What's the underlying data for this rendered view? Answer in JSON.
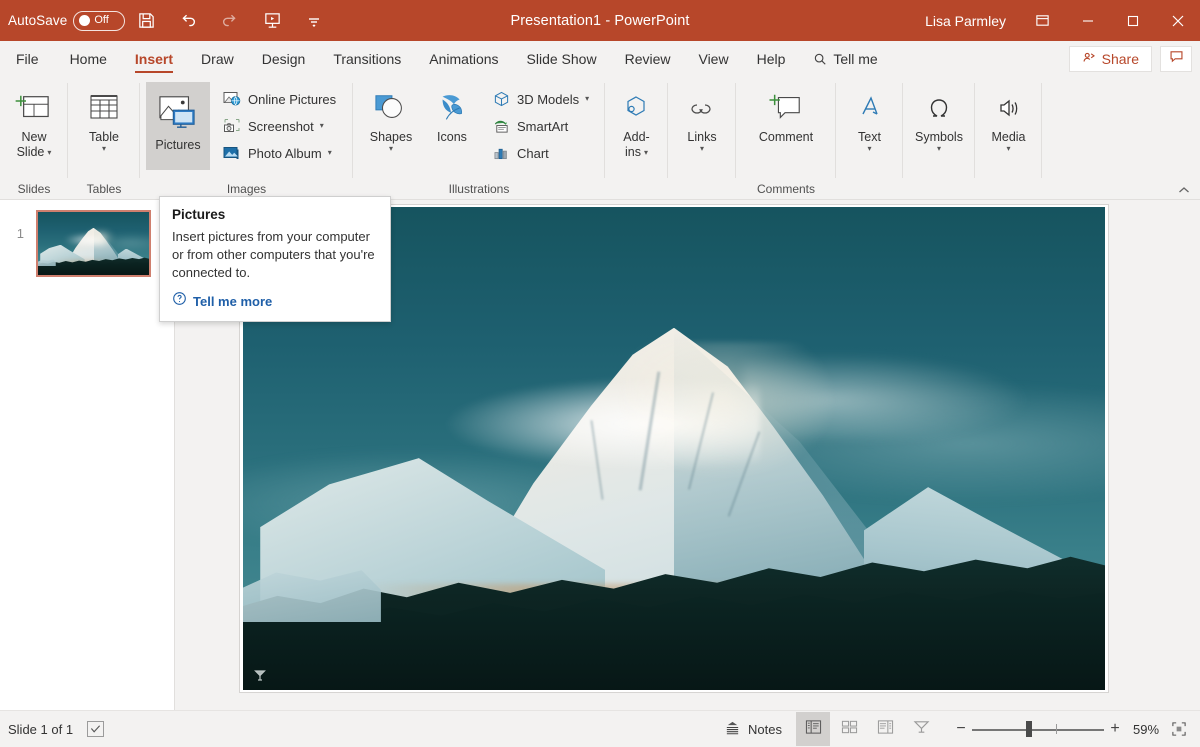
{
  "titlebar": {
    "autosave_label": "AutoSave",
    "autosave_state": "Off",
    "document_title": "Presentation1  -  PowerPoint",
    "user_name": "Lisa Parmley",
    "quick_access": [
      {
        "name": "save-icon",
        "label": "Save"
      },
      {
        "name": "undo-icon",
        "label": "Undo"
      },
      {
        "name": "redo-icon",
        "label": "Redo"
      },
      {
        "name": "start-presentation-icon",
        "label": "Start From Beginning"
      },
      {
        "name": "customize-quick-access-toolbar-icon",
        "label": "Customize Quick Access Toolbar"
      }
    ],
    "window_controls": {
      "ribbon_display_options": "Ribbon Display Options",
      "minimize": "Minimize",
      "restore": "Restore Down",
      "close": "Close"
    },
    "accent_color": "#b7472a"
  },
  "tabs": [
    {
      "label": "File",
      "active": false
    },
    {
      "label": "Home",
      "active": false
    },
    {
      "label": "Insert",
      "active": true
    },
    {
      "label": "Draw",
      "active": false
    },
    {
      "label": "Design",
      "active": false
    },
    {
      "label": "Transitions",
      "active": false
    },
    {
      "label": "Animations",
      "active": false
    },
    {
      "label": "Slide Show",
      "active": false
    },
    {
      "label": "Review",
      "active": false
    },
    {
      "label": "View",
      "active": false
    },
    {
      "label": "Help",
      "active": false
    }
  ],
  "tell_me": {
    "label": "Tell me",
    "icon": "search-icon"
  },
  "tab_actions": {
    "share_label": "Share",
    "share_icon": "share-person-icon",
    "comments_icon": "comment-icon"
  },
  "ribbon": {
    "groups": [
      {
        "id": "slides",
        "label": "Slides",
        "big_buttons": [
          {
            "label_line1": "New",
            "label_line2": "Slide",
            "icon": "new-slide-icon",
            "has_caret": true,
            "highlighted": false
          }
        ],
        "small_buttons": []
      },
      {
        "id": "tables",
        "label": "Tables",
        "big_buttons": [
          {
            "label_line1": "Table",
            "label_line2": "",
            "icon": "table-icon",
            "has_caret": true,
            "highlighted": false
          }
        ],
        "small_buttons": []
      },
      {
        "id": "images",
        "label": "Images",
        "big_buttons": [
          {
            "label_line1": "Pictures",
            "label_line2": "",
            "icon": "pictures-icon",
            "has_caret": false,
            "highlighted": true
          }
        ],
        "small_buttons": [
          {
            "label": "Online Pictures",
            "icon": "online-pictures-icon",
            "has_caret": false
          },
          {
            "label": "Screenshot",
            "icon": "screenshot-icon",
            "has_caret": true
          },
          {
            "label": "Photo Album",
            "icon": "photo-album-icon",
            "has_caret": true
          }
        ]
      },
      {
        "id": "illustrations",
        "label": "Illustrations",
        "big_buttons": [
          {
            "label_line1": "Shapes",
            "label_line2": "",
            "icon": "shapes-icon",
            "has_caret": true,
            "highlighted": false
          },
          {
            "label_line1": "Icons",
            "label_line2": "",
            "icon": "icons-icon",
            "has_caret": false,
            "highlighted": false
          }
        ],
        "small_buttons": [
          {
            "label": "3D Models",
            "icon": "3d-models-icon",
            "has_caret": true
          },
          {
            "label": "SmartArt",
            "icon": "smartart-icon",
            "has_caret": false
          },
          {
            "label": "Chart",
            "icon": "chart-icon",
            "has_caret": false
          }
        ]
      },
      {
        "id": "addins",
        "label": "",
        "big_buttons": [
          {
            "label_line1": "Add-",
            "label_line2": "ins",
            "icon": "add-ins-icon",
            "has_caret": true,
            "highlighted": false
          }
        ],
        "small_buttons": []
      },
      {
        "id": "links",
        "label": "",
        "big_buttons": [
          {
            "label_line1": "Links",
            "label_line2": "",
            "icon": "links-icon",
            "has_caret": true,
            "highlighted": false
          }
        ],
        "small_buttons": []
      },
      {
        "id": "comments",
        "label": "Comments",
        "big_buttons": [
          {
            "label_line1": "Comment",
            "label_line2": "",
            "icon": "new-comment-icon",
            "has_caret": false,
            "highlighted": false
          }
        ],
        "small_buttons": []
      },
      {
        "id": "text",
        "label": "",
        "big_buttons": [
          {
            "label_line1": "Text",
            "label_line2": "",
            "icon": "text-icon",
            "has_caret": true,
            "highlighted": false
          }
        ],
        "small_buttons": []
      },
      {
        "id": "symbols",
        "label": "",
        "big_buttons": [
          {
            "label_line1": "Symbols",
            "label_line2": "",
            "icon": "omega-symbol-icon",
            "has_caret": true,
            "highlighted": false
          }
        ],
        "small_buttons": []
      },
      {
        "id": "media",
        "label": "",
        "big_buttons": [
          {
            "label_line1": "Media",
            "label_line2": "",
            "icon": "media-speaker-icon",
            "has_caret": true,
            "highlighted": false
          }
        ],
        "small_buttons": []
      }
    ],
    "collapse_ribbon_icon": "chevron-up-icon"
  },
  "tooltip": {
    "title": "Pictures",
    "body": "Insert pictures from your computer or from other computers that you're connected to.",
    "link_label": "Tell me more",
    "link_icon": "help-question-icon",
    "link_color": "#1f5fa8"
  },
  "thumbnails": [
    {
      "number": "1",
      "selected": true,
      "alt": "Snow covered mountain peak photograph"
    }
  ],
  "slide": {
    "image_alt": "Snow covered mountain peak with evergreen forest foreground and teal sky",
    "watermark_icon": "photo-credit-icon"
  },
  "statusbar": {
    "slide_count": "Slide 1 of 1",
    "accessibility_icon": "accessibility-checker-icon",
    "notes_label": "Notes",
    "notes_icon": "notes-icon",
    "views": [
      {
        "name": "normal-view-button",
        "icon": "normal-view-icon",
        "active": true
      },
      {
        "name": "slide-sorter-view-button",
        "icon": "slide-sorter-icon",
        "active": false
      },
      {
        "name": "reading-view-button",
        "icon": "reading-view-icon",
        "active": false
      },
      {
        "name": "slide-show-view-button",
        "icon": "slide-show-icon",
        "active": false
      }
    ],
    "zoom": {
      "minus_label": "−",
      "plus_label": "+",
      "percent": "59%",
      "value": 59,
      "fit_icon": "fit-slide-to-window-icon"
    }
  }
}
